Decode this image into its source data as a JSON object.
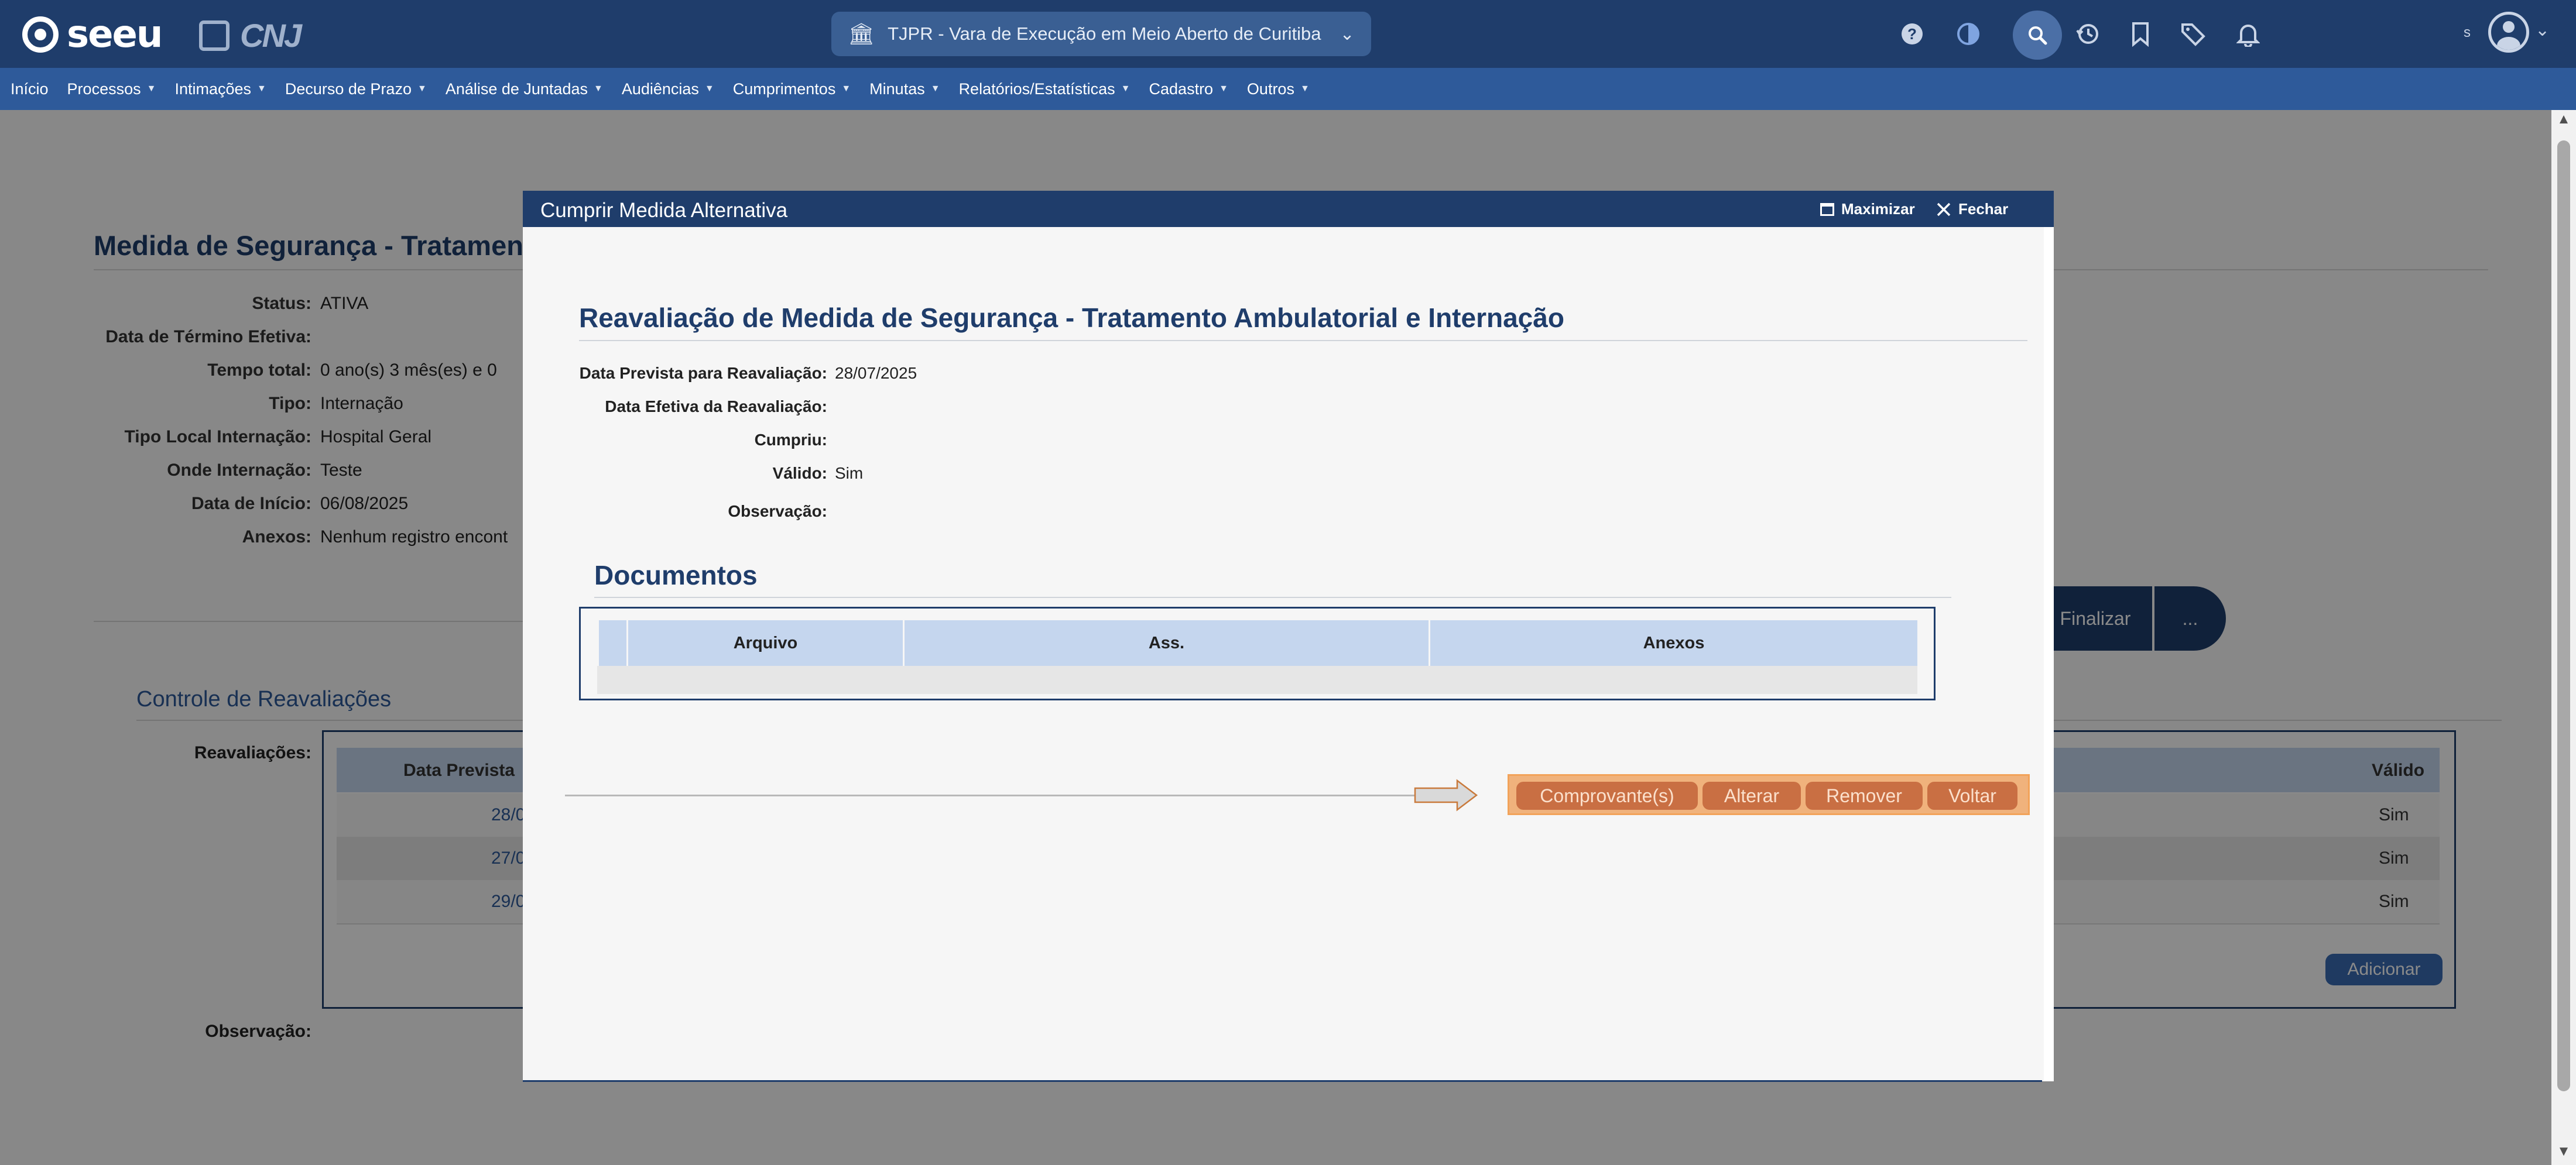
{
  "topbar": {
    "logo_text": "seeu",
    "cnj_text": "CNJ",
    "court_selector": "TJPR - Vara de Execução em Meio Aberto de Curitiba",
    "icons": [
      "help-icon",
      "contrast-icon",
      "search-icon",
      "history-icon",
      "bookmark-icon",
      "tag-icon",
      "bell-icon"
    ],
    "user_initial": "s"
  },
  "menu": [
    {
      "label": "Início",
      "caret": false
    },
    {
      "label": "Processos",
      "caret": true
    },
    {
      "label": "Intimações",
      "caret": true
    },
    {
      "label": "Decurso de Prazo",
      "caret": true
    },
    {
      "label": "Análise de Juntadas",
      "caret": true
    },
    {
      "label": "Audiências",
      "caret": true
    },
    {
      "label": "Cumprimentos",
      "caret": true
    },
    {
      "label": "Minutas",
      "caret": true
    },
    {
      "label": "Relatórios/Estatísticas",
      "caret": true
    },
    {
      "label": "Cadastro",
      "caret": true
    },
    {
      "label": "Outros",
      "caret": true
    }
  ],
  "page": {
    "title": "Medida de Segurança - Tratamento",
    "fields": [
      {
        "label": "Status:",
        "value": "ATIVA"
      },
      {
        "label": "Data de Término Efetiva:",
        "value": ""
      },
      {
        "label": "Tempo total:",
        "value": "0 ano(s)  3 mês(es)  e 0"
      },
      {
        "label": "Tipo:",
        "value": "Internação"
      },
      {
        "label": "Tipo Local Internação:",
        "value": "Hospital Geral"
      },
      {
        "label": "Onde Internação:",
        "value": "Teste"
      },
      {
        "label": "Data de Início:",
        "value": "06/08/2025"
      },
      {
        "label": "Anexos:",
        "value": "Nenhum registro encont"
      }
    ],
    "finalizar_label": "Finalizar",
    "more_label": "...",
    "section_title": "Controle de Reavaliações",
    "reavaliacoes_label": "Reavaliações:",
    "table_header_date": "Data Prevista",
    "table_header_valid": "Válido",
    "rows": [
      {
        "date": "28/0",
        "valid": "Sim"
      },
      {
        "date": "27/0",
        "valid": "Sim"
      },
      {
        "date": "29/0",
        "valid": "Sim"
      }
    ],
    "add_label": "Adicionar",
    "observacao_label": "Observação:"
  },
  "modal": {
    "title": "Cumprir Medida Alternativa",
    "maximize_label": "Maximizar",
    "close_label": "Fechar",
    "heading": "Reavaliação de Medida de Segurança - Tratamento Ambulatorial e Internação",
    "fields": [
      {
        "label": "Data Prevista para Reavaliação:",
        "value": "28/07/2025"
      },
      {
        "label": "Data Efetiva da Reavaliação:",
        "value": ""
      },
      {
        "label": "Cumpriu:",
        "value": ""
      },
      {
        "label": "Válido:",
        "value": "Sim"
      },
      {
        "label": "Observação:",
        "value": ""
      }
    ],
    "documents_title": "Documentos",
    "doc_columns": [
      "Arquivo",
      "Ass.",
      "Anexos"
    ],
    "buttons": {
      "comprovantes": "Comprovante(s)",
      "alterar": "Alterar",
      "remover": "Remover",
      "voltar": "Voltar"
    }
  },
  "colors": {
    "header_bg": "#1f3d6b",
    "menu_bg": "#2e5a9a",
    "highlight_border": "#f2a35a",
    "highlight_fill": "#f0b27c",
    "action_button": "#c96f43"
  }
}
